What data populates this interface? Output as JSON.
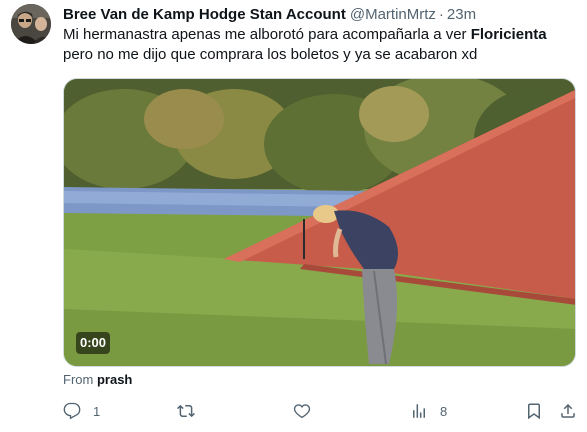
{
  "author": {
    "display_name": "Bree Van de Kamp Hodge Stan Account",
    "handle": "@MartinMrtz",
    "separator": "·",
    "time": "23m"
  },
  "tweet": {
    "text_before": "Mi hermanastra apenas me alborotó para acompañarla a ver ",
    "text_bold": "Floricienta",
    "text_after": " pero no me dijo que comprara los boletos y ya se acabaron xd"
  },
  "media": {
    "timestamp": "0:00"
  },
  "source": {
    "prefix": "From",
    "name": "prash"
  },
  "actions": {
    "reply_count": "1",
    "retweet_count": "",
    "like_count": "",
    "views_count": "8"
  },
  "icons": {
    "reply": "reply-icon",
    "retweet": "retweet-icon",
    "like": "heart-icon",
    "views": "views-icon",
    "bookmark": "bookmark-icon",
    "share": "share-icon"
  }
}
